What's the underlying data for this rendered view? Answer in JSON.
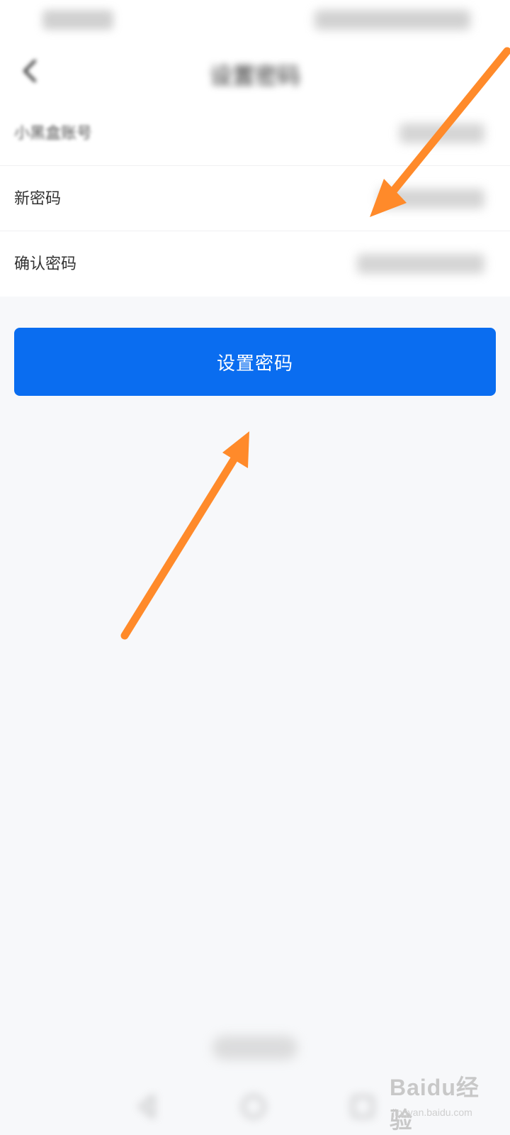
{
  "header": {
    "title": "设置密码",
    "back_icon": "back-icon"
  },
  "list": {
    "items": [
      {
        "label": "小黑盒账号",
        "blurred": true
      },
      {
        "label": "新密码",
        "blurred": false
      },
      {
        "label": "确认密码",
        "blurred": false
      }
    ]
  },
  "actions": {
    "submit_label": "设置密码"
  },
  "watermark": {
    "logo": "Baidu经验",
    "sub": "jingyan.baidu.com"
  },
  "colors": {
    "primary": "#0a6df0",
    "annotation": "#ff8a2a",
    "background": "#f7f8fa"
  }
}
